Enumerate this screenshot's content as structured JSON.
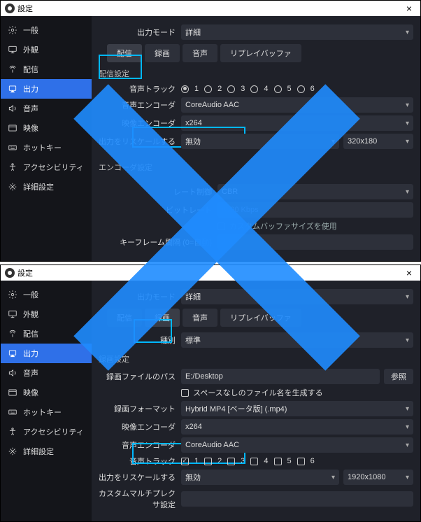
{
  "title": "設定",
  "close": "×",
  "sidebar": {
    "items": [
      {
        "label": "一般",
        "icon": "gear-icon"
      },
      {
        "label": "外観",
        "icon": "monitor-icon"
      },
      {
        "label": "配信",
        "icon": "antenna-icon"
      },
      {
        "label": "出力",
        "icon": "output-icon"
      },
      {
        "label": "音声",
        "icon": "speaker-icon"
      },
      {
        "label": "映像",
        "icon": "video-icon"
      },
      {
        "label": "ホットキー",
        "icon": "keyboard-icon"
      },
      {
        "label": "アクセシビリティ",
        "icon": "accessibility-icon"
      },
      {
        "label": "詳細設定",
        "icon": "tools-icon"
      }
    ]
  },
  "top": {
    "output_mode_label": "出力モード",
    "output_mode_value": "詳細",
    "tabs": [
      "配信",
      "録画",
      "音声",
      "リプレイバッファ"
    ],
    "active_tab": 0,
    "stream_settings_title": "配信設定",
    "audio_track_label": "音声トラック",
    "tracks": [
      "1",
      "2",
      "3",
      "4",
      "5",
      "6"
    ],
    "track_selected": 0,
    "audio_encoder_label": "音声エンコーダ",
    "audio_encoder_value": "CoreAudio AAC",
    "video_encoder_label": "映像エンコーダ",
    "video_encoder_value": "x264",
    "rescale_label": "出力をリスケールする",
    "rescale_value": "無効",
    "rescale_dim": "320x180",
    "encoder_title": "エンコーダ設定",
    "rate_control_label": "レート制御",
    "rate_control_value": "CBR",
    "bitrate_label": "ビットレート",
    "bitrate_value": "6000 Kbps",
    "custom_buffer_label": "カスタムバッファサイズを使用",
    "keyframe_label": "キーフレーム間隔 (0=自動)",
    "keyframe_value": "2 s"
  },
  "bottom": {
    "output_mode_label": "出力モード",
    "output_mode_value": "詳細",
    "tabs": [
      "配信",
      "録画",
      "音声",
      "リプレイバッファ"
    ],
    "active_tab": 1,
    "type_label": "種別",
    "type_value": "標準",
    "rec_settings_title": "録画設定",
    "path_label": "録画ファイルのパス",
    "path_value": "E:/Desktop",
    "browse_label": "参照",
    "nospace_label": "スペースなしのファイル名を生成する",
    "format_label": "録画フォーマット",
    "format_value": "Hybrid MP4 [ベータ版] (.mp4)",
    "video_encoder_label": "映像エンコーダ",
    "video_encoder_value": "x264",
    "audio_encoder_label": "音声エンコーダ",
    "audio_encoder_value": "CoreAudio AAC",
    "audio_track_label": "音声トラック",
    "tracks": [
      "1",
      "2",
      "3",
      "4",
      "5",
      "6"
    ],
    "track_checked": 0,
    "rescale_label": "出力をリスケールする",
    "rescale_value": "無効",
    "rescale_dim": "1920x1080",
    "mux_label": "カスタムマルチプレクサ設定"
  },
  "highlight_color": "#00b8ff",
  "cross_color": "#1f8cff"
}
